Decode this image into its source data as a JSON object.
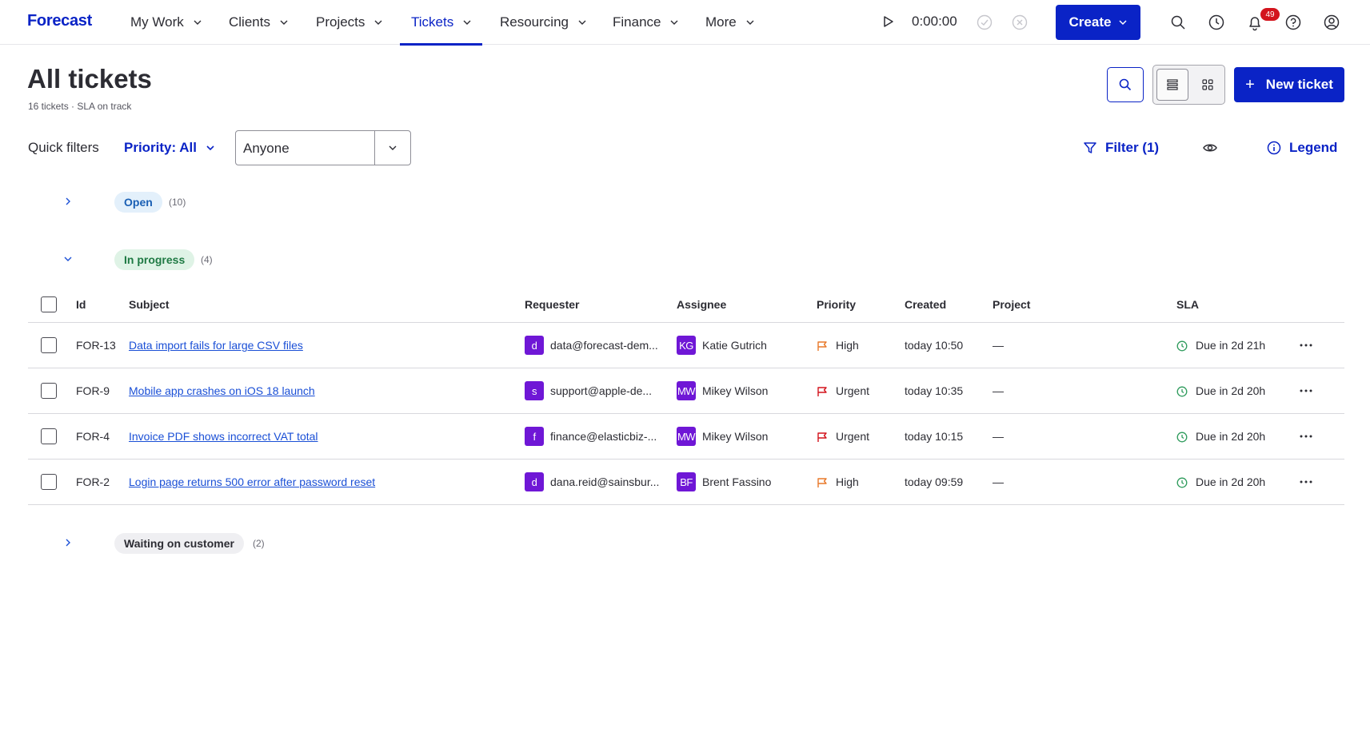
{
  "app": {
    "logo": "Forecast"
  },
  "nav": {
    "items": [
      {
        "label": "My Work"
      },
      {
        "label": "Clients"
      },
      {
        "label": "Projects"
      },
      {
        "label": "Tickets",
        "active": true
      },
      {
        "label": "Resourcing"
      },
      {
        "label": "Finance"
      },
      {
        "label": "More"
      }
    ],
    "timer": "0:00:00",
    "create_label": "Create",
    "notification_count": "49"
  },
  "page": {
    "title": "All tickets",
    "subtitle": "16 tickets · SLA on track",
    "new_ticket_label": "New ticket"
  },
  "filters": {
    "quick_filters_label": "Quick filters",
    "priority_label": "Priority: All",
    "assignee_value": "Anyone",
    "filter_label": "Filter (1)",
    "legend_label": "Legend"
  },
  "groups": {
    "open": {
      "label": "Open",
      "count": "(10)"
    },
    "in_progress": {
      "label": "In progress",
      "count": "(4)"
    },
    "waiting": {
      "label": "Waiting on customer",
      "count": "(2)"
    }
  },
  "table": {
    "columns": [
      "Id",
      "Subject",
      "Requester",
      "Assignee",
      "Priority",
      "Created",
      "Project",
      "SLA"
    ],
    "rows": [
      {
        "id": "FOR-13",
        "subject": "Data import fails for large CSV files",
        "requester_initial": "d",
        "requester": "data@forecast-dem...",
        "assignee_initials": "KG",
        "assignee": "Katie Gutrich",
        "priority": "High",
        "created": "today 10:50",
        "project": "—",
        "sla": "Due in 2d 21h"
      },
      {
        "id": "FOR-9",
        "subject": "Mobile app crashes on iOS 18 launch",
        "requester_initial": "s",
        "requester": "support@apple-de...",
        "assignee_initials": "MW",
        "assignee": "Mikey Wilson",
        "priority": "Urgent",
        "created": "today 10:35",
        "project": "—",
        "sla": "Due in 2d 20h"
      },
      {
        "id": "FOR-4",
        "subject": "Invoice PDF shows incorrect VAT total",
        "requester_initial": "f",
        "requester": "finance@elasticbiz-...",
        "assignee_initials": "MW",
        "assignee": "Mikey Wilson",
        "priority": "Urgent",
        "created": "today 10:15",
        "project": "—",
        "sla": "Due in 2d 20h"
      },
      {
        "id": "FOR-2",
        "subject": "Login page returns 500 error after password reset",
        "requester_initial": "d",
        "requester": "dana.reid@sainsbur...",
        "assignee_initials": "BF",
        "assignee": "Brent Fassino",
        "priority": "High",
        "created": "today 09:59",
        "project": "—",
        "sla": "Due in 2d 20h"
      }
    ]
  },
  "colors": {
    "brand": "#0a23c6",
    "avatar": "#6f17d6",
    "high_flag": "#e8792a",
    "urgent_flag": "#d3141d",
    "sla_ok": "#2e9b5c",
    "open_pill_bg": "#e3f0fb",
    "open_pill_fg": "#1a5fb4",
    "progress_pill_bg": "#dff3e6",
    "progress_pill_fg": "#1f7a44",
    "waiting_pill_bg": "#efeff2"
  },
  "icons": {
    "play": "play-icon",
    "check_circle": "check-circle-icon",
    "x_circle": "x-circle-icon",
    "search": "search-icon",
    "clock": "clock-icon",
    "bell": "bell-icon",
    "help": "help-icon",
    "user": "user-icon",
    "list_view": "list-view-icon",
    "grid_view": "grid-view-icon",
    "filter": "filter-icon",
    "eye": "eye-icon",
    "info": "info-icon",
    "flag": "flag-icon",
    "more": "more-icon"
  }
}
